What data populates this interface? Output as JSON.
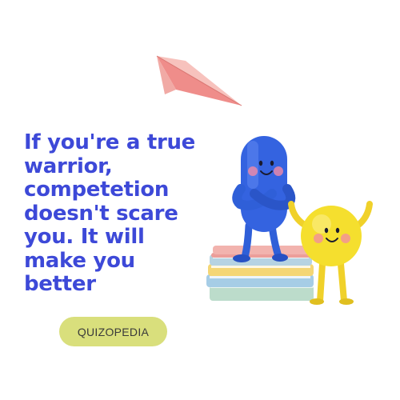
{
  "quote": {
    "lines": [
      "If you're a true",
      "warrior,",
      "competetion",
      "doesn't scare",
      "you. It will",
      "make you",
      "better"
    ],
    "color": "#3d49d8"
  },
  "badge": {
    "label": "QUIZOPEDIA",
    "color": "#d9df7c"
  },
  "illustrations": {
    "plane_color": "#e89a96",
    "blue_character_color": "#2f5fd8",
    "yellow_character_color": "#f5df2e",
    "book_colors": [
      "#ec9e9a",
      "#b6d3e2",
      "#f4d675",
      "#a6cde6",
      "#bcdccb"
    ]
  }
}
